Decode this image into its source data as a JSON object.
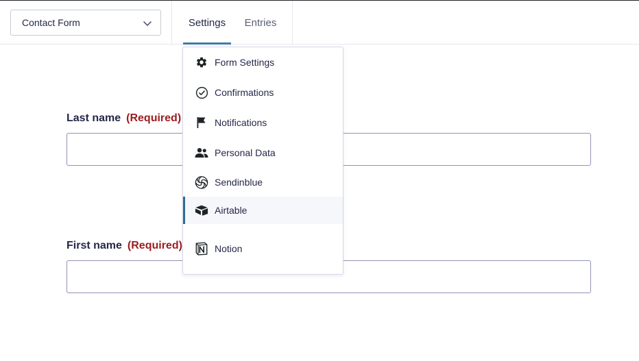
{
  "header": {
    "form_select": {
      "value": "Contact Form",
      "icon": "chevron-down-icon"
    },
    "tabs": [
      {
        "label": "Settings",
        "active": true
      },
      {
        "label": "Entries",
        "active": false
      }
    ]
  },
  "settings_menu": {
    "items": [
      {
        "label": "Form Settings",
        "icon": "gear-icon"
      },
      {
        "label": "Confirmations",
        "icon": "check-circle-icon"
      },
      {
        "label": "Notifications",
        "icon": "flag-icon"
      },
      {
        "label": "Personal Data",
        "icon": "users-icon"
      },
      {
        "label": "Sendinblue",
        "icon": "sendinblue-icon"
      },
      {
        "label": "Airtable",
        "icon": "airtable-icon",
        "active": true
      },
      {
        "label": "Notion",
        "icon": "notion-icon"
      }
    ]
  },
  "form": {
    "fields": [
      {
        "label": "Last name",
        "required_text": "(Required)",
        "value": ""
      },
      {
        "label": "First name",
        "required_text": "(Required)",
        "value": ""
      }
    ]
  },
  "colors": {
    "accent": "#3e7da6",
    "required": "#9e1d22",
    "text": "#242748"
  }
}
